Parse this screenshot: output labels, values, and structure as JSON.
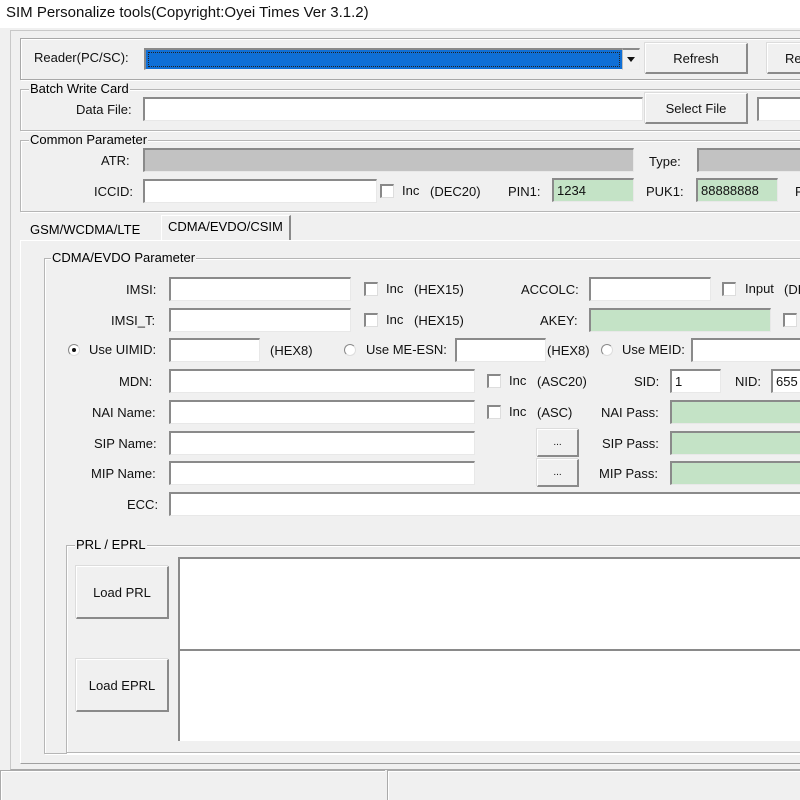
{
  "window": {
    "title": "SIM Personalize tools(Copyright:Oyei Times Ver 3.1.2)"
  },
  "reader": {
    "label": "Reader(PC/SC):",
    "selected_value": "",
    "refresh_label": "Refresh",
    "second_button_label": "Re"
  },
  "batch": {
    "group_title": "Batch Write Card",
    "data_file_label": "Data File:",
    "data_file_value": "",
    "select_file_label": "Select File"
  },
  "common": {
    "group_title": "Common Parameter",
    "atr_label": "ATR:",
    "atr_value": "",
    "type_label": "Type:",
    "type_value": "",
    "iccid_label": "ICCID:",
    "iccid_value": "",
    "iccid_inc_label": "Inc",
    "iccid_inc_checked": false,
    "iccid_format": "(DEC20)",
    "pin1_label": "PIN1:",
    "pin1_value": "1234",
    "puk1_label": "PUK1:",
    "puk1_value": "88888888",
    "cutoff_label": "P"
  },
  "tabs": [
    {
      "label": "GSM/WCDMA/LTE",
      "active": false
    },
    {
      "label": "CDMA/EVDO/CSIM",
      "active": true
    }
  ],
  "cdma": {
    "group_title": "CDMA/EVDO Parameter",
    "imsi_label": "IMSI:",
    "imsi_value": "",
    "imsi_inc_label": "Inc",
    "imsi_format": "(HEX15)",
    "imsi_t_label": "IMSI_T:",
    "imsi_t_value": "",
    "imsi_t_inc_label": "Inc",
    "imsi_t_format": "(HEX15)",
    "accolc_label": "ACCOLC:",
    "accolc_value": "",
    "accolc_input_label": "Input",
    "accolc_input_format": "(DE",
    "akey_label": "AKEY:",
    "akey_value": "",
    "use_uimid_label": "Use UIMID:",
    "use_uimid_selected": true,
    "uimid_value": "",
    "uimid_format": "(HEX8)",
    "use_me_esn_label": "Use ME-ESN:",
    "use_me_esn_selected": false,
    "me_esn_value": "",
    "me_esn_format": "(HEX8)",
    "use_meid_label": "Use MEID:",
    "use_meid_selected": false,
    "meid_value": "",
    "mdn_label": "MDN:",
    "mdn_value": "",
    "mdn_inc_label": "Inc",
    "mdn_format": "(ASC20)",
    "sid_label": "SID:",
    "sid_value": "1",
    "nid_label": "NID:",
    "nid_value": "655",
    "nai_name_label": "NAI Name:",
    "nai_name_value": "",
    "nai_inc_label": "Inc",
    "nai_format": "(ASC)",
    "nai_pass_label": "NAI Pass:",
    "nai_pass_value": "",
    "sip_name_label": "SIP Name:",
    "sip_name_value": "",
    "sip_browse_label": "...",
    "sip_pass_label": "SIP Pass:",
    "sip_pass_value": "",
    "mip_name_label": "MIP Name:",
    "mip_name_value": "",
    "mip_browse_label": "...",
    "mip_pass_label": "MIP Pass:",
    "mip_pass_value": "",
    "ecc_label": "ECC:",
    "ecc_value": ""
  },
  "prl": {
    "group_title": "PRL / EPRL",
    "load_prl_label": "Load PRL",
    "load_eprl_label": "Load EPRL",
    "prl_content": "",
    "eprl_content": ""
  },
  "status": {
    "left": "",
    "right": ""
  }
}
